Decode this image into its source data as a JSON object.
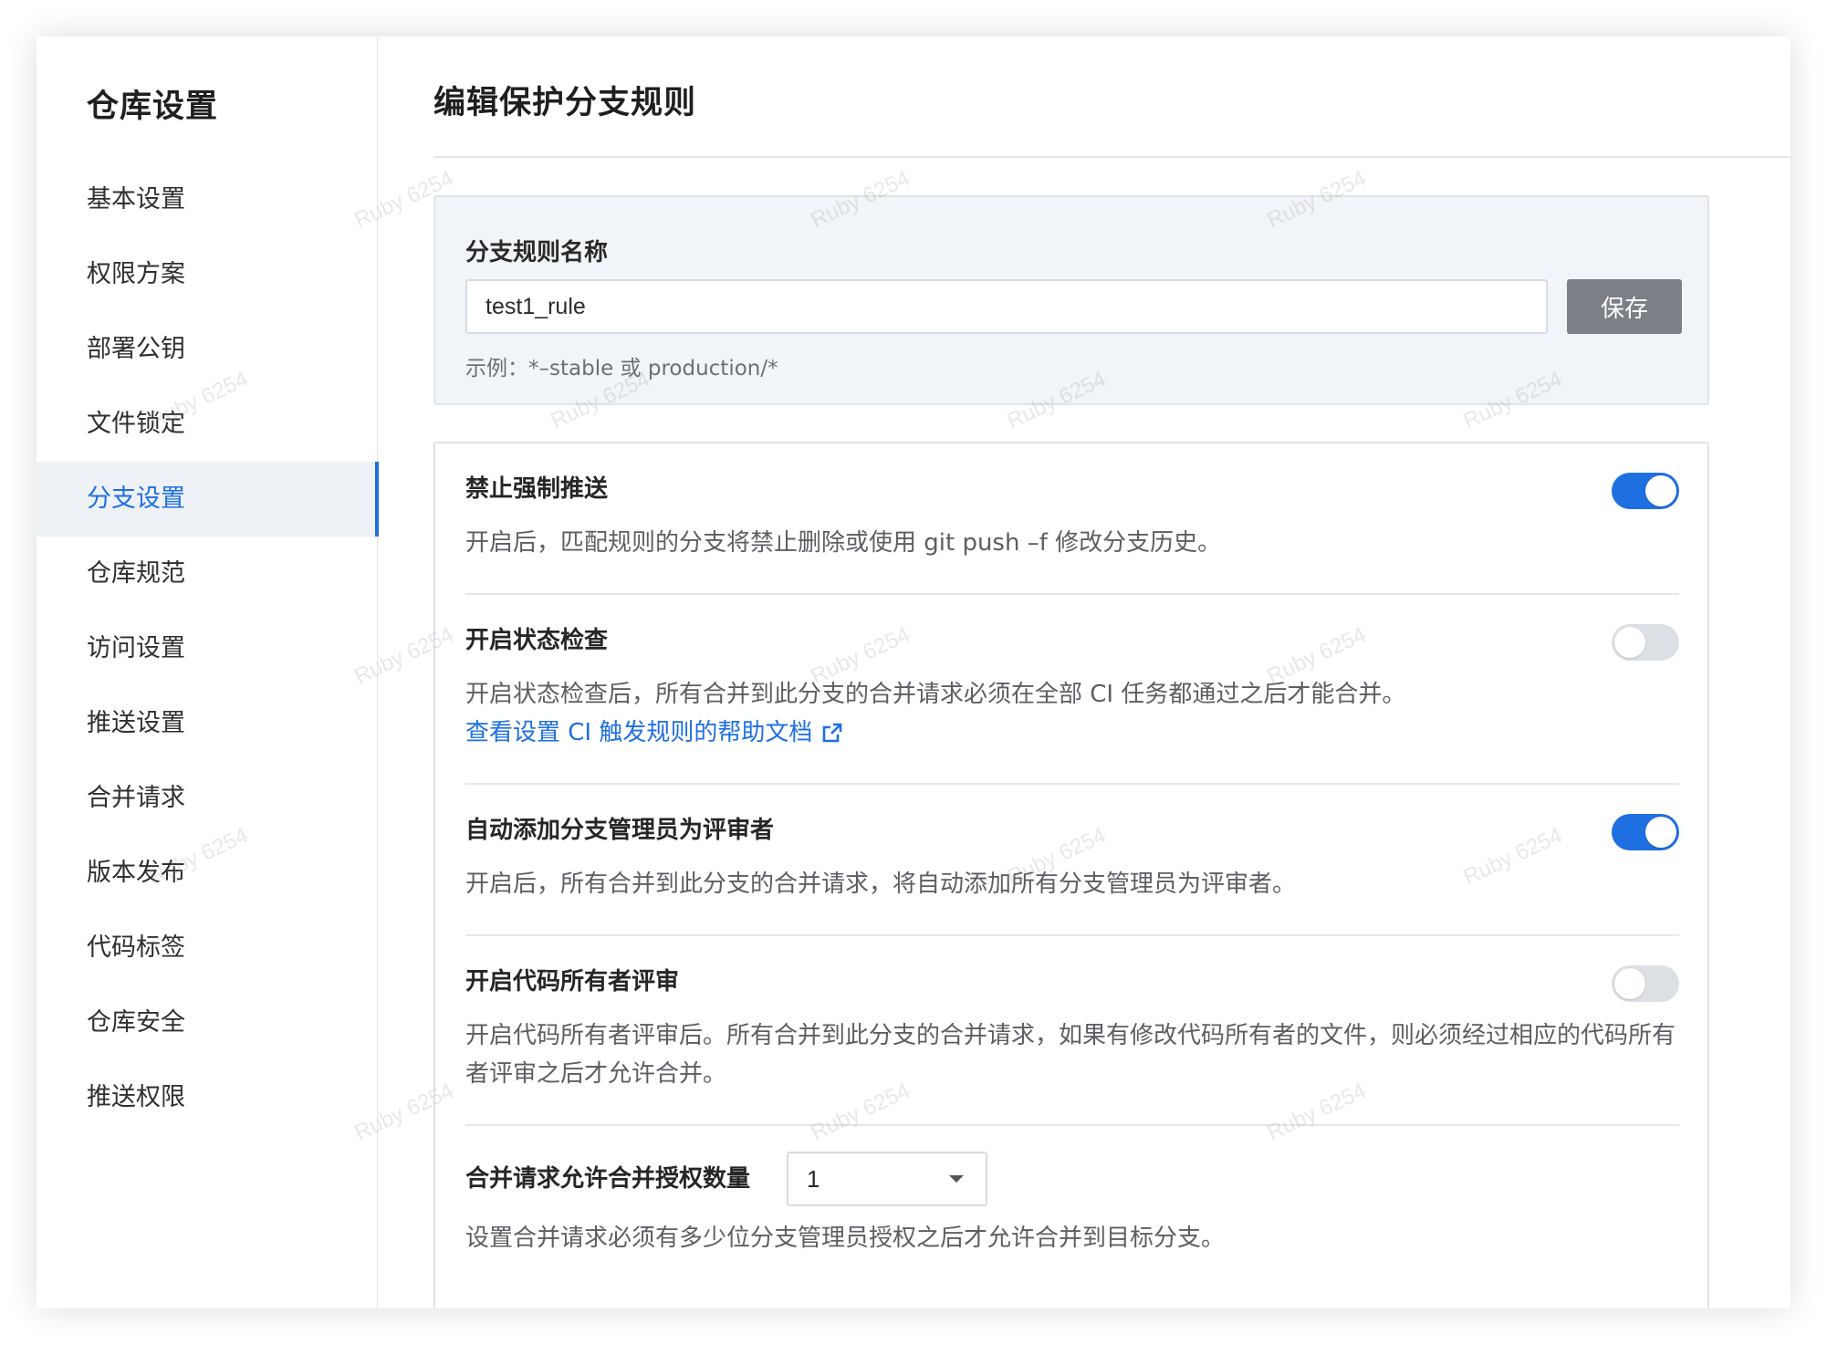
{
  "sidebar": {
    "title": "仓库设置",
    "items": [
      {
        "label": "基本设置",
        "active": false
      },
      {
        "label": "权限方案",
        "active": false
      },
      {
        "label": "部署公钥",
        "active": false
      },
      {
        "label": "文件锁定",
        "active": false
      },
      {
        "label": "分支设置",
        "active": true
      },
      {
        "label": "仓库规范",
        "active": false
      },
      {
        "label": "访问设置",
        "active": false
      },
      {
        "label": "推送设置",
        "active": false
      },
      {
        "label": "合并请求",
        "active": false
      },
      {
        "label": "版本发布",
        "active": false
      },
      {
        "label": "代码标签",
        "active": false
      },
      {
        "label": "仓库安全",
        "active": false
      },
      {
        "label": "推送权限",
        "active": false
      }
    ]
  },
  "page": {
    "title": "编辑保护分支规则"
  },
  "rule_name": {
    "label": "分支规则名称",
    "value": "test1_rule",
    "save_label": "保存",
    "hint": "示例：*–stable 或 production/*"
  },
  "settings": {
    "force_push": {
      "title": "禁止强制推送",
      "desc": "开启后，匹配规则的分支将禁止删除或使用 git push –f 修改分支历史。",
      "enabled": true
    },
    "status_check": {
      "title": "开启状态检查",
      "desc": "开启状态检查后，所有合并到此分支的合并请求必须在全部 CI 任务都通过之后才能合并。",
      "link": "查看设置 CI 触发规则的帮助文档",
      "enabled": false
    },
    "auto_reviewer": {
      "title": "自动添加分支管理员为评审者",
      "desc": "开启后，所有合并到此分支的合并请求，将自动添加所有分支管理员为评审者。",
      "enabled": true
    },
    "code_owner": {
      "title": "开启代码所有者评审",
      "desc": "开启代码所有者评审后。所有合并到此分支的合并请求，如果有修改代码所有者的文件，则必须经过相应的代码所有者评审之后才允许合并。",
      "enabled": false
    },
    "approval_count": {
      "title": "合并请求允许合并授权数量",
      "value": "1",
      "desc": "设置合并请求必须有多少位分支管理员授权之后才允许合并到目标分支。"
    }
  },
  "watermark": "Ruby 6254",
  "colors": {
    "accent": "#1e6fe0",
    "save_button": "#7b7f86",
    "toggle_off": "#dcdfe4"
  }
}
